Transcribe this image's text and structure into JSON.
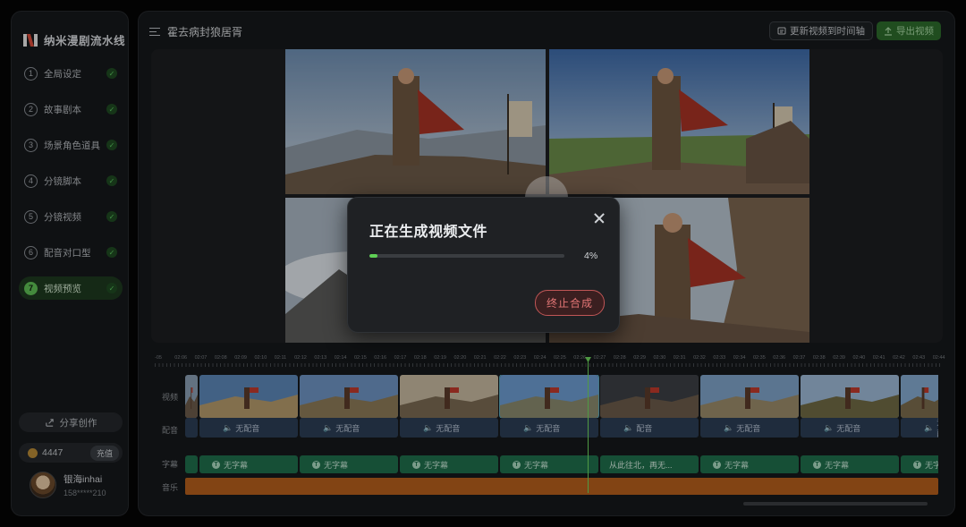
{
  "app": {
    "title": "纳米漫剧流水线",
    "project_title": "霍去病封狼居胥"
  },
  "steps": [
    {
      "num": "1",
      "label": "全局设定",
      "done": true,
      "active": false
    },
    {
      "num": "2",
      "label": "故事剧本",
      "done": true,
      "active": false
    },
    {
      "num": "3",
      "label": "场景角色道具",
      "done": true,
      "active": false
    },
    {
      "num": "4",
      "label": "分镜脚本",
      "done": true,
      "active": false
    },
    {
      "num": "5",
      "label": "分镜视频",
      "done": true,
      "active": false
    },
    {
      "num": "6",
      "label": "配音对口型",
      "done": true,
      "active": false
    },
    {
      "num": "7",
      "label": "视频预览",
      "done": true,
      "active": true
    }
  ],
  "sidebar": {
    "share_label": "分享创作",
    "credits": "4447",
    "recharge_label": "充值",
    "user_name": "银海inhai",
    "user_phone": "158*****210"
  },
  "toolbar": {
    "update_label": "更新视频到时间轴",
    "export_label": "导出视频"
  },
  "modal": {
    "title": "正在生成视频文件",
    "progress_percent": 4,
    "progress_text": "4%",
    "stop_label": "终止合成"
  },
  "timeline": {
    "ticks": [
      "-05",
      "02:06",
      "02:07",
      "02:08",
      "02:09",
      "02:10",
      "02:11",
      "02:12",
      "02:13",
      "02:14",
      "02:15",
      "02:16",
      "02:17",
      "02:18",
      "02:19",
      "02:20",
      "02:21",
      "02:22",
      "02:23",
      "02:24",
      "02:25",
      "02:26",
      "02:27",
      "02:28",
      "02:29",
      "02:30",
      "02:31",
      "02:32",
      "02:33",
      "02:34",
      "02:35",
      "02:36",
      "02:37",
      "02:38",
      "02:39",
      "02:40",
      "02:41",
      "02:42",
      "02:43",
      "02:44"
    ],
    "track_labels": {
      "video": "视频",
      "audio": "配音",
      "subtitle": "字幕",
      "music": "音乐"
    },
    "audio_clips": [
      "",
      "无配音",
      "无配音",
      "无配音",
      "无配音",
      "配音",
      "无配音",
      "无配音",
      "无配"
    ],
    "subtitle_clips": [
      "",
      "无字幕",
      "无字幕",
      "无字幕",
      "无字幕",
      "从此往北，再无...",
      "无字幕",
      "无字幕",
      "无字"
    ]
  },
  "colors": {
    "accent_green": "#5fcf55",
    "stop_red": "#e27575",
    "music_orange": "#b45f1c",
    "subtitle_green": "#1f6e4c"
  }
}
